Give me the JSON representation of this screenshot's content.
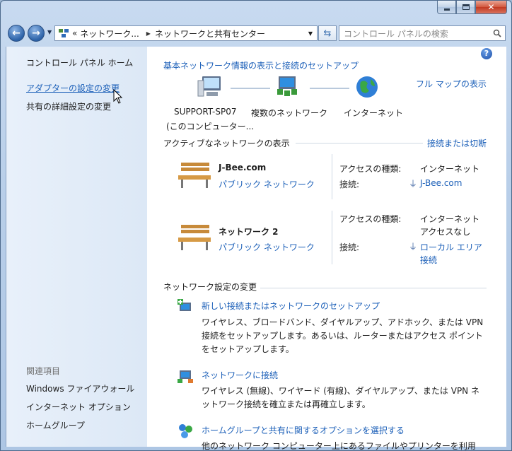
{
  "window": {
    "nav": {
      "address_segments": [
        "«",
        "ネットワーク...",
        "ネットワークと共有センター"
      ],
      "search_placeholder": "コントロール パネルの検索"
    }
  },
  "left_pane": {
    "items": [
      {
        "label": "コントロール パネル ホーム"
      },
      {
        "label": "アダプターの設定の変更"
      },
      {
        "label": "共有の詳細設定の変更"
      }
    ],
    "related_title": "関連項目",
    "related": [
      {
        "label": "Windows ファイアウォール"
      },
      {
        "label": "インターネット オプション"
      },
      {
        "label": "ホームグループ"
      }
    ]
  },
  "main": {
    "header_link": "基本ネットワーク情報の表示と接続のセットアップ",
    "full_map_link": "フル マップの表示",
    "map": {
      "computer_line1": "SUPPORT-SP07",
      "computer_line2": "(このコンピューター...",
      "multi_networks": "複数のネットワーク",
      "internet": "インターネット"
    },
    "active_title": "アクティブなネットワークの表示",
    "connect_link": "接続または切断",
    "networks": [
      {
        "name": "J-Bee.com",
        "type": "パブリック ネットワーク",
        "access_label": "アクセスの種類:",
        "access_value": "インターネット",
        "conn_label": "接続:",
        "conn_value": "J-Bee.com"
      },
      {
        "name": "ネットワーク  2",
        "type": "パブリック ネットワーク",
        "access_label": "アクセスの種類:",
        "access_value_line1": "インターネット",
        "access_value_line2": "アクセスなし",
        "conn_label": "接続:",
        "conn_value_line1": "ローカル エリア",
        "conn_value_line2": "接続"
      }
    ],
    "settings_title": "ネットワーク設定の変更",
    "tasks": [
      {
        "title": "新しい接続またはネットワークのセットアップ",
        "desc1": "ワイヤレス、ブロードバンド、ダイヤルアップ、アドホック、または VPN",
        "desc2": "接続をセットアップします。あるいは、ルーターまたはアクセス ポイント",
        "desc3": "をセットアップします。"
      },
      {
        "title": "ネットワークに接続",
        "desc1": "ワイヤレス (無線)、ワイヤード (有線)、ダイヤルアップ、または VPN ネ",
        "desc2": "ットワーク接続を確立または再確立します。"
      },
      {
        "title": "ホームグループと共有に関するオプションを選択する",
        "desc1": "他のネットワーク コンピューター上にあるファイルやプリンターを利用"
      }
    ]
  },
  "colors": {
    "link": "#1b5fb8",
    "chrome": "#b9cfe9",
    "close_button": "#c13a22"
  }
}
